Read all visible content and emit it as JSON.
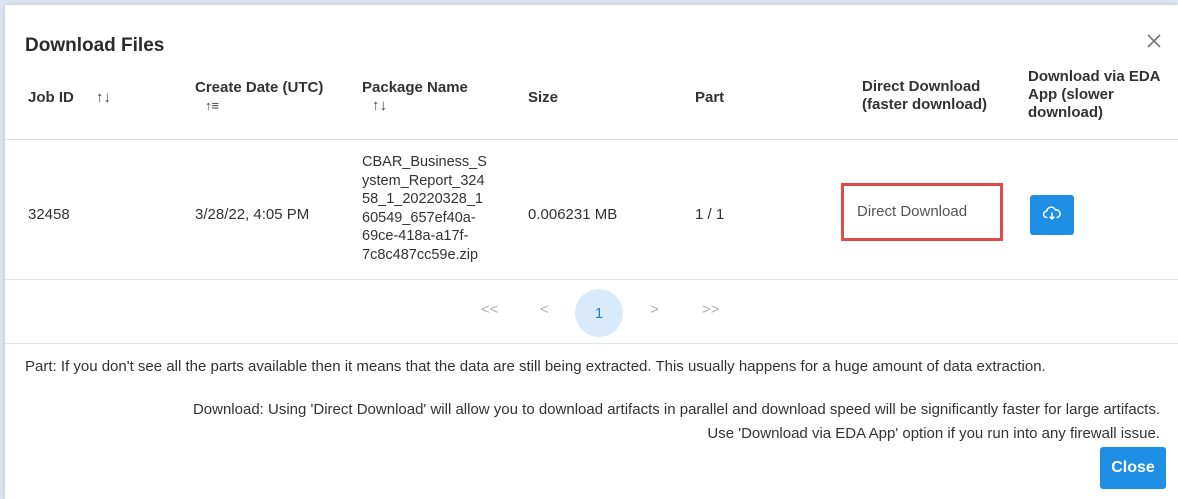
{
  "dialog": {
    "title": "Download Files",
    "close_icon": "close-icon"
  },
  "table": {
    "headers": {
      "job_id": "Job ID",
      "create_date": "Create Date (UTC)",
      "package_name": "Package Name",
      "size": "Size",
      "part": "Part",
      "direct_download": [
        "Direct Download",
        "(faster download)"
      ],
      "eda_app": [
        "Download via EDA",
        "App (slower",
        "download)"
      ]
    },
    "sort_icons": {
      "job_id": "↑↓",
      "create_date": "↑≡",
      "package_name": "↑↓"
    },
    "rows": [
      {
        "job_id": "32458",
        "create_date": "3/28/22, 4:05 PM",
        "package_name": [
          "CBAR_Business_S",
          "ystem_Report_324",
          "58_1_20220328_1",
          "60549_657ef40a-",
          "69ce-418a-a17f-",
          "7c8c487cc59e.zip"
        ],
        "size": "0.006231 MB",
        "part": "1 / 1",
        "direct_download_label": "Direct Download",
        "eda_icon": "cloud-download-icon"
      }
    ]
  },
  "pagination": {
    "first": "<<",
    "prev": "<",
    "current": "1",
    "next": ">",
    "last": ">>"
  },
  "notes": {
    "part": "Part: If you don't see all the parts available then it means that the data are still being extracted. This usually happens for a huge amount of data extraction.",
    "download_1": "Download: Using 'Direct Download' will allow you to download artifacts in parallel and download speed will be significantly faster for large artifacts.",
    "download_2": "Use 'Download via EDA App' option if you run into any firewall issue."
  },
  "footer": {
    "close_label": "Close"
  },
  "colors": {
    "accent": "#1f8fe6",
    "highlight_border": "#e04a4a"
  }
}
